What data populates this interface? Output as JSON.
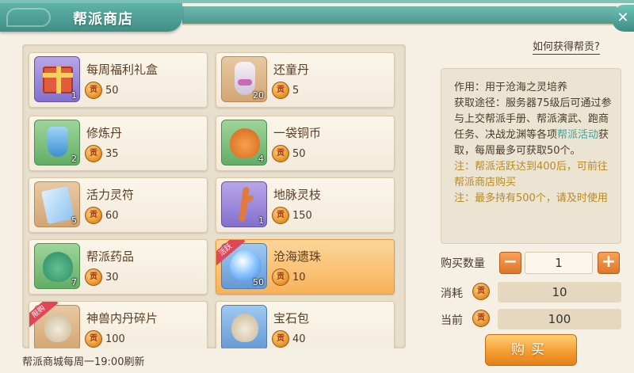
{
  "window": {
    "title": "帮派商店",
    "close_label": "✕"
  },
  "help_link": "如何获得帮贡?",
  "currency_icon_label": "贡",
  "items": [
    {
      "name": "每周福利礼盒",
      "price": "50",
      "count": "1",
      "icon": "gift-box-icon"
    },
    {
      "name": "还童丹",
      "price": "5",
      "count": "20",
      "icon": "vase-icon"
    },
    {
      "name": "修炼丹",
      "price": "35",
      "count": "2",
      "icon": "flask-icon"
    },
    {
      "name": "一袋铜币",
      "price": "50",
      "count": "4",
      "icon": "coin-bag-icon"
    },
    {
      "name": "活力灵符",
      "price": "60",
      "count": "5",
      "icon": "talisman-icon"
    },
    {
      "name": "地脉灵枝",
      "price": "150",
      "count": "1",
      "icon": "branch-icon"
    },
    {
      "name": "帮派药品",
      "price": "30",
      "count": "7",
      "icon": "medicine-bag-icon"
    },
    {
      "name": "沧海遗珠",
      "price": "10",
      "count": "50",
      "icon": "pearl-icon",
      "badge": "活跃",
      "selected": true
    },
    {
      "name": "神兽内丹碎片",
      "price": "100",
      "count": "",
      "icon": "sack-icon",
      "badge": "限购"
    },
    {
      "name": "宝石包",
      "price": "40",
      "count": "",
      "icon": "gem-bag-icon"
    }
  ],
  "detail": {
    "usage": "作用：用于沧海之灵培养",
    "source_prefix": "获取途径：服务器75级后可通过参与上交帮派手册、帮派演武、跑商任务、决战龙渊等各项",
    "source_link": "帮派活动",
    "source_suffix": "获取，每周最多可获取50个。",
    "note1": "注：帮派活跃达到400后，可前往帮派商店购买",
    "note2": "注：最多持有500个，请及时使用"
  },
  "purchase": {
    "quantity_label": "购买数量",
    "quantity": "1",
    "minus": "−",
    "plus": "+",
    "cost_label": "消耗",
    "cost": "10",
    "current_label": "当前",
    "current": "100",
    "buy_label": "购买"
  },
  "footer": "帮派商城每周一19:00刷新",
  "colors": {
    "accent_teal": "#4e9a92",
    "selected_orange": "#f7b25a",
    "highlight_link": "#3ea29a",
    "note_gold": "#b98a1f"
  }
}
